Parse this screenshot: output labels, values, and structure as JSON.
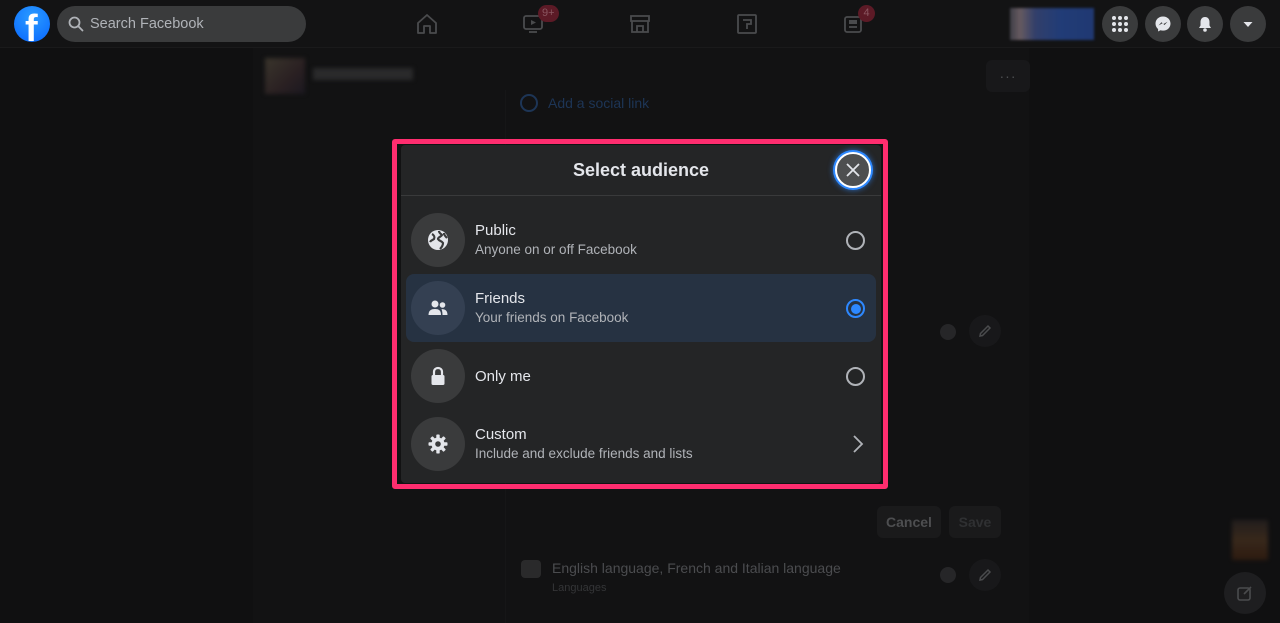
{
  "topbar": {
    "logo_letter": "f",
    "search_placeholder": "Search Facebook",
    "nav_tabs": [
      {
        "name": "home",
        "icon": "home-icon",
        "badge": null
      },
      {
        "name": "watch",
        "icon": "video-icon",
        "badge": "9+"
      },
      {
        "name": "marketplace",
        "icon": "store-icon",
        "badge": null
      },
      {
        "name": "groups",
        "icon": "groups-icon",
        "badge": null
      },
      {
        "name": "news",
        "icon": "news-icon",
        "badge": "4"
      }
    ],
    "right_buttons": [
      "menu-grid-icon",
      "messenger-icon",
      "bell-icon",
      "caret-down-icon"
    ]
  },
  "background": {
    "more_label": "···",
    "add_link_label": "Add a social link",
    "cancel_label": "Cancel",
    "save_label": "Save",
    "languages_value": "English language, French and Italian language",
    "languages_label": "Languages"
  },
  "modal": {
    "title": "Select audience",
    "options": [
      {
        "label": "Public",
        "description": "Anyone on or off Facebook",
        "icon": "globe-icon",
        "selected": false,
        "control": "radio"
      },
      {
        "label": "Friends",
        "description": "Your friends on Facebook",
        "icon": "friends-icon",
        "selected": true,
        "control": "radio"
      },
      {
        "label": "Only me",
        "description": "",
        "icon": "lock-icon",
        "selected": false,
        "control": "radio"
      },
      {
        "label": "Custom",
        "description": "Include and exclude friends and lists",
        "icon": "gear-icon",
        "selected": false,
        "control": "chevron"
      }
    ]
  },
  "colors": {
    "accent": "#2d88ff",
    "highlight_border": "#ff2d6f",
    "modal_bg": "#242526",
    "selected_row_bg": "#263242"
  }
}
